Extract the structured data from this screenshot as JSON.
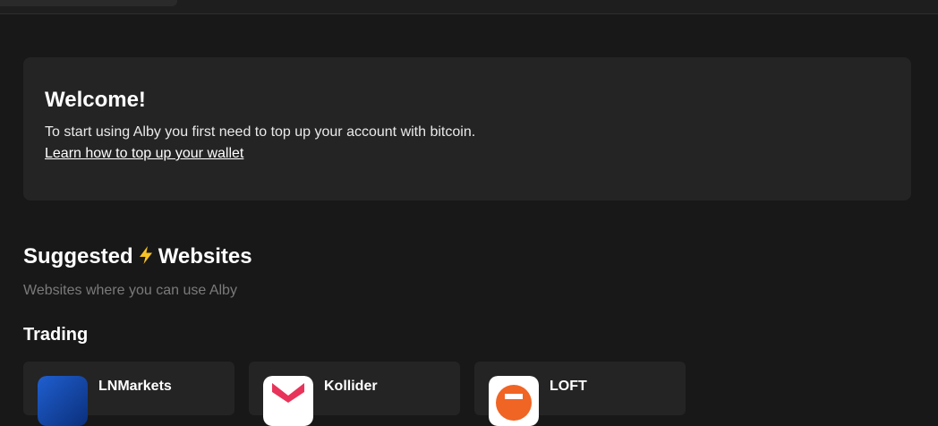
{
  "welcome": {
    "title": "Welcome!",
    "text": "To start using Alby you first need to top up your account with bitcoin.",
    "link": "Learn how to top up your wallet"
  },
  "suggested": {
    "heading_before": "Suggested",
    "heading_after": "Websites",
    "subtitle": "Websites where you can use Alby"
  },
  "categories": [
    {
      "name": "Trading",
      "sites": [
        {
          "name": "LNMarkets",
          "icon": "lnmarkets-logo-icon"
        },
        {
          "name": "Kollider",
          "icon": "kollider-logo-icon"
        },
        {
          "name": "LOFT",
          "icon": "loft-logo-icon"
        }
      ]
    }
  ],
  "colors": {
    "background": "#181818",
    "card": "#242424",
    "muted_text": "#7a7a7a",
    "bolt": "#f7c325"
  }
}
